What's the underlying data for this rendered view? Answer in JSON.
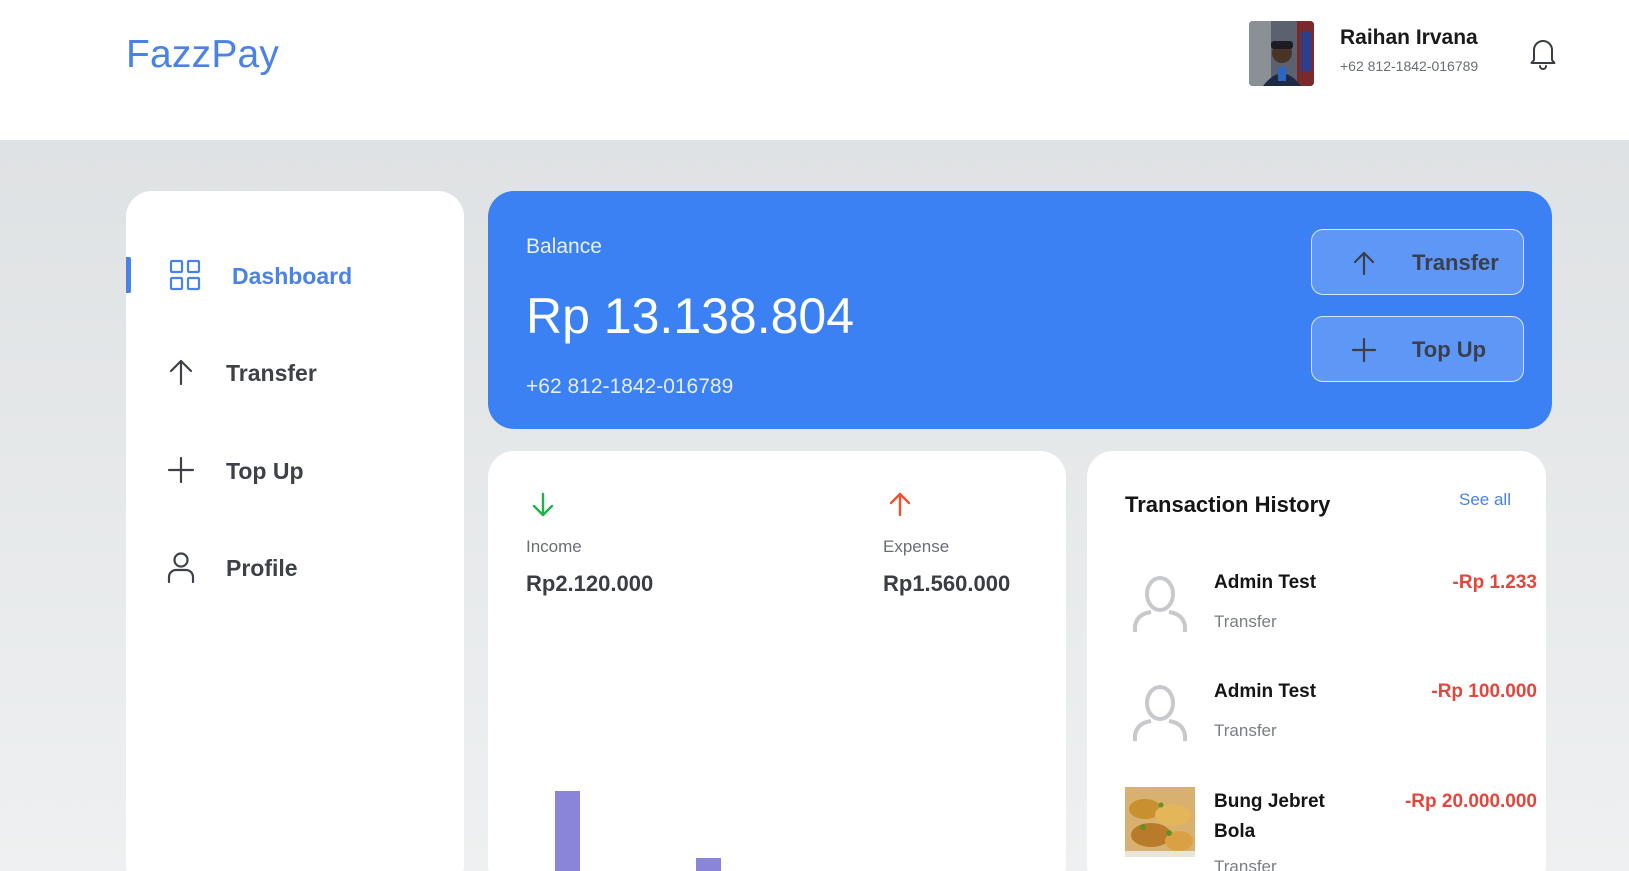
{
  "header": {
    "brand": "FazzPay",
    "user_name": "Raihan Irvana",
    "user_phone": "+62 812-1842-016789"
  },
  "sidebar": {
    "items": [
      {
        "label": "Dashboard",
        "icon": "grid-icon",
        "active": true
      },
      {
        "label": "Transfer",
        "icon": "arrow-up-icon",
        "active": false
      },
      {
        "label": "Top Up",
        "icon": "plus-icon",
        "active": false
      },
      {
        "label": "Profile",
        "icon": "user-icon",
        "active": false
      }
    ]
  },
  "balance": {
    "label": "Balance",
    "amount": "Rp 13.138.804",
    "phone": "+62 812-1842-016789",
    "transfer_label": "Transfer",
    "topup_label": "Top Up"
  },
  "stats": {
    "income_label": "Income",
    "income_value": "Rp2.120.000",
    "expense_label": "Expense",
    "expense_value": "Rp1.560.000"
  },
  "history": {
    "title": "Transaction History",
    "see_all": "See all",
    "items": [
      {
        "name": "Admin Test",
        "type": "Transfer",
        "amount": "-Rp 1.233",
        "thumb": "default-user-icon"
      },
      {
        "name": "Admin Test",
        "type": "Transfer",
        "amount": "-Rp 100.000",
        "thumb": "default-user-icon"
      },
      {
        "name": "Bung Jebret Bola",
        "type": "Transfer",
        "amount": "-Rp 20.000.000",
        "thumb": "food-photo"
      }
    ]
  },
  "colors": {
    "accent": "#3c81f4",
    "income": "#22b04b",
    "expense": "#f0512f",
    "negative_amount": "#e2463c",
    "chart_bar": "#8a85d8"
  }
}
